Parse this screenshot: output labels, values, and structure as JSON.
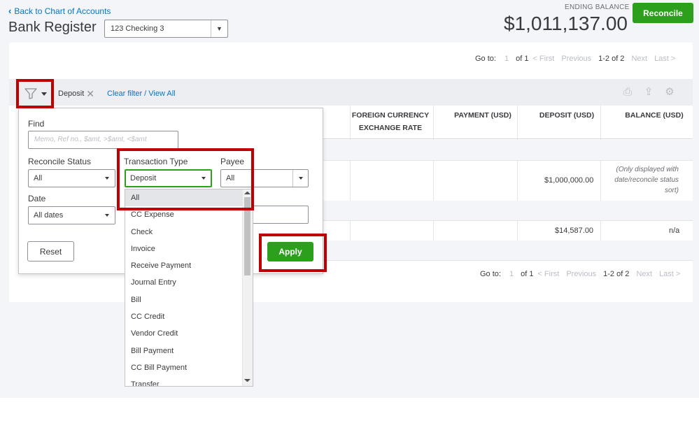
{
  "header": {
    "back_link": "Back to Chart of Accounts",
    "title": "Bank Register",
    "account_select": "123 Checking 3",
    "ending_balance_label": "ENDING BALANCE",
    "ending_balance": "$1,011,137.00",
    "reconcile_label": "Reconcile"
  },
  "pager": {
    "goto_label": "Go to:",
    "page_input": "1",
    "of_label": "of 1",
    "first": "< First",
    "previous": "Previous",
    "range": "1-2 of 2",
    "next": "Next",
    "last": "Last >"
  },
  "toolbar": {
    "chip_label": "Deposit",
    "clear_filter": "Clear filter / View All"
  },
  "table": {
    "columns": {
      "foreign_currency_line1": "FOREIGN CURRENCY",
      "foreign_currency_line2": "EXCHANGE RATE",
      "payment": "PAYMENT (USD)",
      "deposit": "DEPOSIT (USD)",
      "balance": "BALANCE (USD)"
    },
    "rows": [
      {
        "deposit": "$1,000,000.00",
        "balance_note": "(Only displayed with date/reconcile status sort)"
      },
      {
        "deposit": "$14,587.00",
        "balance": "n/a"
      }
    ]
  },
  "filter_panel": {
    "find_label": "Find",
    "find_placeholder": "Memo, Ref no., $amt, >$amt, <$amt",
    "reconcile_status_label": "Reconcile Status",
    "reconcile_status_value": "All",
    "transaction_type_label": "Transaction Type",
    "transaction_type_value": "Deposit",
    "payee_label": "Payee",
    "payee_value": "All",
    "date_label": "Date",
    "date_value": "All dates",
    "reset_label": "Reset",
    "apply_label": "Apply"
  },
  "dropdown_options": [
    "All",
    "CC Expense",
    "Check",
    "Invoice",
    "Receive Payment",
    "Journal Entry",
    "Bill",
    "CC Credit",
    "Vendor Credit",
    "Bill Payment",
    "CC Bill Payment",
    "Transfer"
  ],
  "colors": {
    "accent_green": "#2ca01c",
    "link_blue": "#0077c5",
    "highlight_red": "#c00000"
  }
}
